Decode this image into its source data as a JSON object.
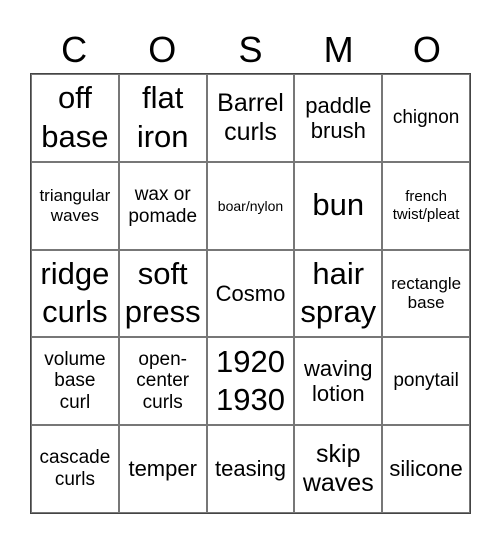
{
  "header": [
    "C",
    "O",
    "S",
    "M",
    "O"
  ],
  "cells": [
    "off\nbase",
    "flat\niron",
    "Barrel\ncurls",
    "paddle\nbrush",
    "chignon",
    "triangular\nwaves",
    "wax or\npomade",
    "boar/nylon",
    "bun",
    "french\ntwist/pleat",
    "ridge\ncurls",
    "soft\npress",
    "Cosmo",
    "hair\nspray",
    "rectangle\nbase",
    "volume\nbase\ncurl",
    "open-\ncenter\ncurls",
    "1920\n1930",
    "waving\nlotion",
    "ponytail",
    "cascade\ncurls",
    "temper",
    "teasing",
    "skip\nwaves",
    "silicone"
  ]
}
